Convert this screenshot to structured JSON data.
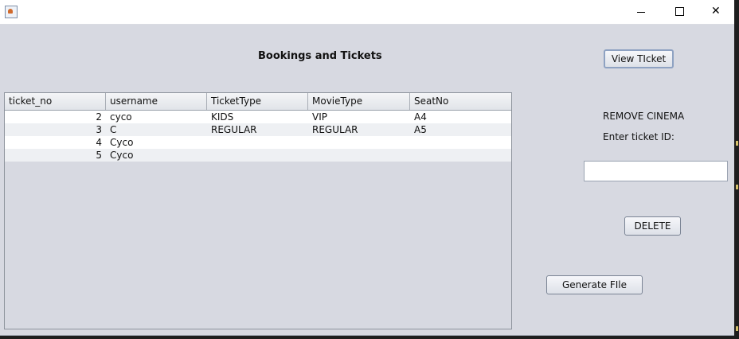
{
  "window": {
    "title": ""
  },
  "heading": "Bookings and Tickets",
  "buttons": {
    "view_ticket": "View TIcket",
    "delete": "DELETE",
    "generate_file": "Generate FIle"
  },
  "remove_panel": {
    "title": "REMOVE CINEMA",
    "prompt": "Enter ticket ID:",
    "ticket_id_value": ""
  },
  "table": {
    "columns": [
      "ticket_no",
      "username",
      "TicketType",
      "MovieType",
      "SeatNo"
    ],
    "rows": [
      [
        "2",
        "cyco",
        "KIDS",
        "VIP",
        "A4"
      ],
      [
        "3",
        "C",
        "REGULAR",
        "REGULAR",
        "A5"
      ],
      [
        "4",
        "Cyco",
        "",
        "",
        ""
      ],
      [
        "5",
        "Cyco",
        "",
        "",
        ""
      ]
    ]
  },
  "colors": {
    "window_bg": "#d7d9e1",
    "row_alt": "#eef0f3",
    "row": "#ffffff"
  }
}
